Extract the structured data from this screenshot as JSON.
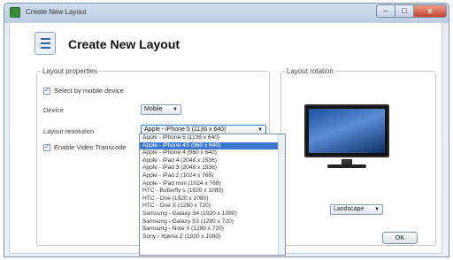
{
  "window": {
    "title": "Create New Layout",
    "controls": {
      "minimize": "–",
      "maximize": "□",
      "close": "x"
    }
  },
  "header": {
    "title": "Create New Layout",
    "icon": "document-icon"
  },
  "layout_properties": {
    "legend": "Layout properties",
    "select_by_mobile_device": {
      "label": "Select by mobile device",
      "checked": true
    },
    "device_label": "Device",
    "device_value": "Mobile",
    "resolution_label": "Layout resolution",
    "resolution_value": "Apple - iPhone 5 (1136 x 640)",
    "video_transcode": {
      "label": "Enable Video Transcode",
      "checked": true
    }
  },
  "resolution_options": [
    "Apple - iPhone 5 (1136 x 640)",
    "Apple - iPhone 4S (960 x 640)",
    "Apple - iPhone 4 (960 x 640)",
    "Apple - iPad 4 (2048 x 1536)",
    "Apple - iPad 3 (2048 x 1536)",
    "Apple - iPad 2 (1024 x 768)",
    "Apple - iPad mini (1024 x 768)",
    "HTC - Butterfly s (1920 x 1080)",
    "HTC - One (1920 x 1080)",
    "HTC - One X (1280 x 720)",
    "Samsung - Galaxy S4 (1920 x 1080)",
    "Samsung - Galaxy S3 (1280 x 720)",
    "Samsung - Note II (1280 x 720)",
    "Sony - Xperia Z (1920 x 1080)"
  ],
  "selected_option_index": 1,
  "layout_rotation": {
    "legend": "Layout rotation",
    "value": "Landscape"
  },
  "ok_label": "OK",
  "colors": {
    "selection": "#3b78cf",
    "close_button": "#c7412a"
  }
}
